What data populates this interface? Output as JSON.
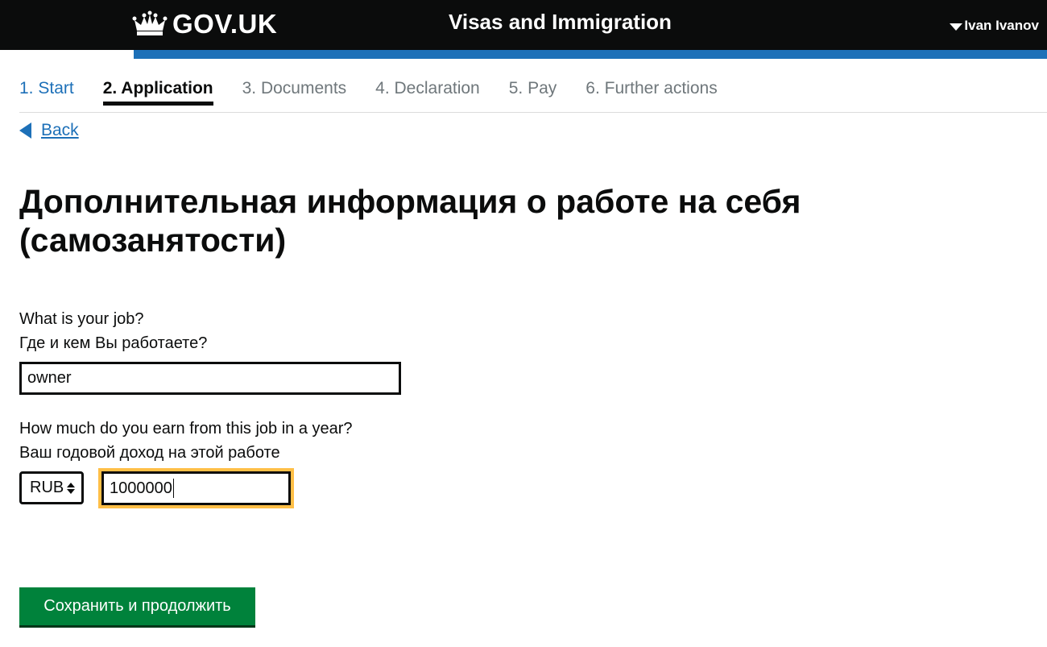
{
  "header": {
    "logo_text": "GOV.UK",
    "service_name": "Visas and Immigration",
    "user_name": "Ivan Ivanov"
  },
  "steps": [
    {
      "label": "1. Start",
      "state": "done"
    },
    {
      "label": "2. Application",
      "state": "current"
    },
    {
      "label": "3. Documents",
      "state": "todo"
    },
    {
      "label": "4. Declaration",
      "state": "todo"
    },
    {
      "label": "5. Pay",
      "state": "todo"
    },
    {
      "label": "6. Further actions",
      "state": "todo"
    }
  ],
  "back_link": "Back",
  "heading": "Дополнительная информация о работе на себя (самозанятости)",
  "job_field": {
    "label_en": "What is your job?",
    "label_ru": "Где и кем Вы работаете?",
    "value": "owner"
  },
  "income_field": {
    "label_en": "How much do you earn from this job in a year?",
    "label_ru": "Ваш годовой доход на этой работе",
    "currency": "RUB",
    "value": "1000000"
  },
  "submit_label": "Сохранить и продолжить",
  "colors": {
    "header_bg": "#0b0c0c",
    "header_accent": "#1d70b8",
    "link": "#1d70b8",
    "focus": "#ffbf47",
    "button": "#00823b"
  }
}
